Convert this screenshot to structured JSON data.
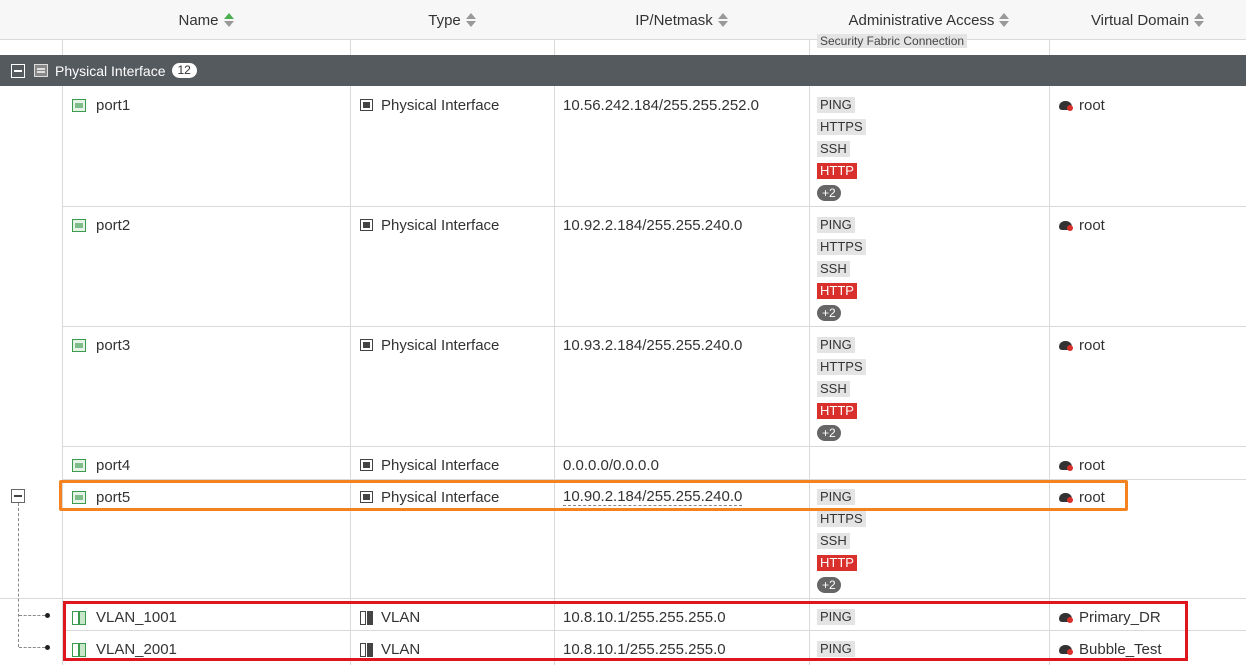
{
  "columns": {
    "name": "Name",
    "type": "Type",
    "ip": "IP/Netmask",
    "access": "Administrative Access",
    "vdom": "Virtual Domain"
  },
  "partial_row": {
    "access_badge": "Security Fabric Connection"
  },
  "group": {
    "label": "Physical Interface",
    "count": "12"
  },
  "rows": [
    {
      "name": "port1",
      "type": "Physical Interface",
      "ip": "10.56.242.184/255.255.252.0",
      "access": [
        "PING",
        "HTTPS",
        "SSH",
        "HTTP"
      ],
      "more": "+2",
      "vdom": "root"
    },
    {
      "name": "port2",
      "type": "Physical Interface",
      "ip": "10.92.2.184/255.255.240.0",
      "access": [
        "PING",
        "HTTPS",
        "SSH",
        "HTTP"
      ],
      "more": "+2",
      "vdom": "root"
    },
    {
      "name": "port3",
      "type": "Physical Interface",
      "ip": "10.93.2.184/255.255.240.0",
      "access": [
        "PING",
        "HTTPS",
        "SSH",
        "HTTP"
      ],
      "more": "+2",
      "vdom": "root"
    },
    {
      "name": "port4",
      "type": "Physical Interface",
      "ip": "0.0.0.0/0.0.0.0",
      "access": [],
      "more": "",
      "vdom": "root"
    },
    {
      "name": "port5",
      "type": "Physical Interface",
      "ip": "10.90.2.184/255.255.240.0",
      "access": [
        "PING",
        "HTTPS",
        "SSH",
        "HTTP"
      ],
      "more": "+2",
      "vdom": "root"
    },
    {
      "name": "VLAN_1001",
      "type": "VLAN",
      "ip": "10.8.10.1/255.255.255.0",
      "access": [
        "PING"
      ],
      "more": "",
      "vdom": "Primary_DR"
    },
    {
      "name": "VLAN_2001",
      "type": "VLAN",
      "ip": "10.8.10.1/255.255.255.0",
      "access": [
        "PING"
      ],
      "more": "",
      "vdom": "Bubble_Test"
    }
  ],
  "colors": {
    "http_badge": "#d9302b",
    "group_bar": "#555a5f",
    "highlight_orange": "#f58220",
    "highlight_red": "#e0161e",
    "port_icon": "#3c9a4c"
  }
}
